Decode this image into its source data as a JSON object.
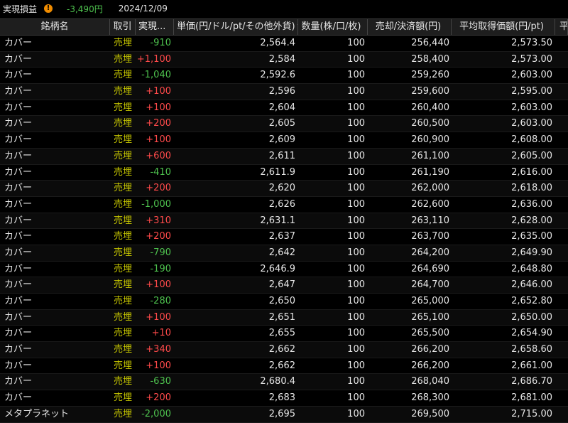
{
  "topbar": {
    "label": "実現損益",
    "warn_icon": "!",
    "pl_value": "-3,490円",
    "date": "2024/12/09"
  },
  "columns": {
    "name": "銘柄名",
    "trade": "取引",
    "pl": "実現...",
    "price": "単価(円/ドル/pt/その他外貨)",
    "qty": "数量(株/口/枚)",
    "amount": "売却/決済額(円)",
    "avg": "平均取得価額(円/pt)",
    "extra": "平"
  },
  "colors": {
    "positive": "#ff4a4a",
    "negative": "#4ec24e",
    "trade": "#c8c800",
    "background": "#000000"
  },
  "rows": [
    {
      "name": "カバー",
      "trade": "売埋",
      "pl": "-910",
      "price": "2,564.4",
      "qty": "100",
      "amount": "256,440",
      "avg": "2,573.50"
    },
    {
      "name": "カバー",
      "trade": "売埋",
      "pl": "+1,100",
      "price": "2,584",
      "qty": "100",
      "amount": "258,400",
      "avg": "2,573.00"
    },
    {
      "name": "カバー",
      "trade": "売埋",
      "pl": "-1,040",
      "price": "2,592.6",
      "qty": "100",
      "amount": "259,260",
      "avg": "2,603.00"
    },
    {
      "name": "カバー",
      "trade": "売埋",
      "pl": "+100",
      "price": "2,596",
      "qty": "100",
      "amount": "259,600",
      "avg": "2,595.00"
    },
    {
      "name": "カバー",
      "trade": "売埋",
      "pl": "+100",
      "price": "2,604",
      "qty": "100",
      "amount": "260,400",
      "avg": "2,603.00"
    },
    {
      "name": "カバー",
      "trade": "売埋",
      "pl": "+200",
      "price": "2,605",
      "qty": "100",
      "amount": "260,500",
      "avg": "2,603.00"
    },
    {
      "name": "カバー",
      "trade": "売埋",
      "pl": "+100",
      "price": "2,609",
      "qty": "100",
      "amount": "260,900",
      "avg": "2,608.00"
    },
    {
      "name": "カバー",
      "trade": "売埋",
      "pl": "+600",
      "price": "2,611",
      "qty": "100",
      "amount": "261,100",
      "avg": "2,605.00"
    },
    {
      "name": "カバー",
      "trade": "売埋",
      "pl": "-410",
      "price": "2,611.9",
      "qty": "100",
      "amount": "261,190",
      "avg": "2,616.00"
    },
    {
      "name": "カバー",
      "trade": "売埋",
      "pl": "+200",
      "price": "2,620",
      "qty": "100",
      "amount": "262,000",
      "avg": "2,618.00"
    },
    {
      "name": "カバー",
      "trade": "売埋",
      "pl": "-1,000",
      "price": "2,626",
      "qty": "100",
      "amount": "262,600",
      "avg": "2,636.00"
    },
    {
      "name": "カバー",
      "trade": "売埋",
      "pl": "+310",
      "price": "2,631.1",
      "qty": "100",
      "amount": "263,110",
      "avg": "2,628.00"
    },
    {
      "name": "カバー",
      "trade": "売埋",
      "pl": "+200",
      "price": "2,637",
      "qty": "100",
      "amount": "263,700",
      "avg": "2,635.00"
    },
    {
      "name": "カバー",
      "trade": "売埋",
      "pl": "-790",
      "price": "2,642",
      "qty": "100",
      "amount": "264,200",
      "avg": "2,649.90"
    },
    {
      "name": "カバー",
      "trade": "売埋",
      "pl": "-190",
      "price": "2,646.9",
      "qty": "100",
      "amount": "264,690",
      "avg": "2,648.80"
    },
    {
      "name": "カバー",
      "trade": "売埋",
      "pl": "+100",
      "price": "2,647",
      "qty": "100",
      "amount": "264,700",
      "avg": "2,646.00"
    },
    {
      "name": "カバー",
      "trade": "売埋",
      "pl": "-280",
      "price": "2,650",
      "qty": "100",
      "amount": "265,000",
      "avg": "2,652.80"
    },
    {
      "name": "カバー",
      "trade": "売埋",
      "pl": "+100",
      "price": "2,651",
      "qty": "100",
      "amount": "265,100",
      "avg": "2,650.00"
    },
    {
      "name": "カバー",
      "trade": "売埋",
      "pl": "+10",
      "price": "2,655",
      "qty": "100",
      "amount": "265,500",
      "avg": "2,654.90"
    },
    {
      "name": "カバー",
      "trade": "売埋",
      "pl": "+340",
      "price": "2,662",
      "qty": "100",
      "amount": "266,200",
      "avg": "2,658.60"
    },
    {
      "name": "カバー",
      "trade": "売埋",
      "pl": "+100",
      "price": "2,662",
      "qty": "100",
      "amount": "266,200",
      "avg": "2,661.00"
    },
    {
      "name": "カバー",
      "trade": "売埋",
      "pl": "-630",
      "price": "2,680.4",
      "qty": "100",
      "amount": "268,040",
      "avg": "2,686.70"
    },
    {
      "name": "カバー",
      "trade": "売埋",
      "pl": "+200",
      "price": "2,683",
      "qty": "100",
      "amount": "268,300",
      "avg": "2,681.00"
    },
    {
      "name": "メタプラネット",
      "trade": "売埋",
      "pl": "-2,000",
      "price": "2,695",
      "qty": "100",
      "amount": "269,500",
      "avg": "2,715.00"
    }
  ]
}
